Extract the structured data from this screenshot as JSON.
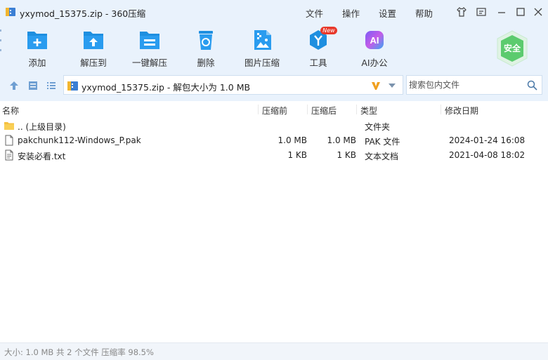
{
  "window": {
    "title": "yxymod_15375.zip - 360压缩",
    "menus": [
      "文件",
      "操作",
      "设置",
      "帮助"
    ]
  },
  "toolbar": {
    "tools": [
      {
        "label": "添加",
        "icon": "add-file-icon"
      },
      {
        "label": "解压到",
        "icon": "extract-to-icon"
      },
      {
        "label": "一键解压",
        "icon": "one-click-extract-icon"
      },
      {
        "label": "删除",
        "icon": "recycle-bin-icon"
      },
      {
        "label": "图片压缩",
        "icon": "image-compress-icon"
      },
      {
        "label": "工具",
        "icon": "tools-icon",
        "badge": "New"
      },
      {
        "label": "AI办公",
        "icon": "ai-office-icon",
        "icon_text": "AI"
      }
    ],
    "safe_badge": "安全"
  },
  "address": {
    "path": "yxymod_15375.zip - 解包大小为 1.0 MB"
  },
  "search": {
    "placeholder": "搜索包内文件"
  },
  "columns": {
    "name": "名称",
    "compressed_before": "压缩前",
    "compressed_after": "压缩后",
    "type": "类型",
    "modified": "修改日期"
  },
  "files": [
    {
      "name": ".. (上级目录)",
      "size_before": "",
      "size_after": "",
      "type": "文件夹",
      "modified": "",
      "icon": "folder-icon"
    },
    {
      "name": "pakchunk112-Windows_P.pak",
      "size_before": "1.0 MB",
      "size_after": "1.0 MB",
      "type": "PAK 文件",
      "modified": "2024-01-24 16:08",
      "icon": "file-icon"
    },
    {
      "name": "安装必看.txt",
      "size_before": "1 KB",
      "size_after": "1 KB",
      "type": "文本文档",
      "modified": "2021-04-08 18:02",
      "icon": "text-file-icon"
    }
  ],
  "status": {
    "text": "大小: 1.0 MB 共 2 个文件 压缩率 98.5%"
  },
  "colors": {
    "chrome_bg": "#e9f2fc",
    "accent_blue": "#1e8fe0",
    "safe_green": "#5ccb6e",
    "new_badge": "#e8392b"
  }
}
